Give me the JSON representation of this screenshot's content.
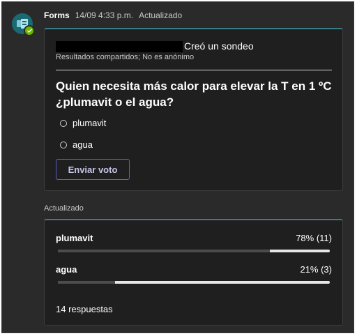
{
  "message": {
    "app_name": "Forms",
    "timestamp": "14/09 4:33 p.m.",
    "status": "Actualizado"
  },
  "poll": {
    "created_text": "Creó un sondeo",
    "subtitle": "Resultados compartidos; No es anónimo",
    "question_line1": "Quien necesita más calor para elevar la T en 1 ºC",
    "question_line2": "¿plumavit o el agua?",
    "options": [
      "plumavit",
      "agua"
    ],
    "vote_label": "Enviar voto"
  },
  "results": {
    "section_label": "Actualizado",
    "items": [
      {
        "name": "plumavit",
        "percent_text": "78% (11)",
        "fraction": 0.78
      },
      {
        "name": "agua",
        "percent_text": "21% (3)",
        "fraction": 0.21
      }
    ],
    "total_text": "14 respuestas"
  },
  "colors": {
    "accent": "#5b5fc7",
    "teal": "#3b7c87",
    "status_green": "#6bb700"
  },
  "icons": {
    "avatar": "forms-app-icon",
    "status": "check-status-icon"
  }
}
